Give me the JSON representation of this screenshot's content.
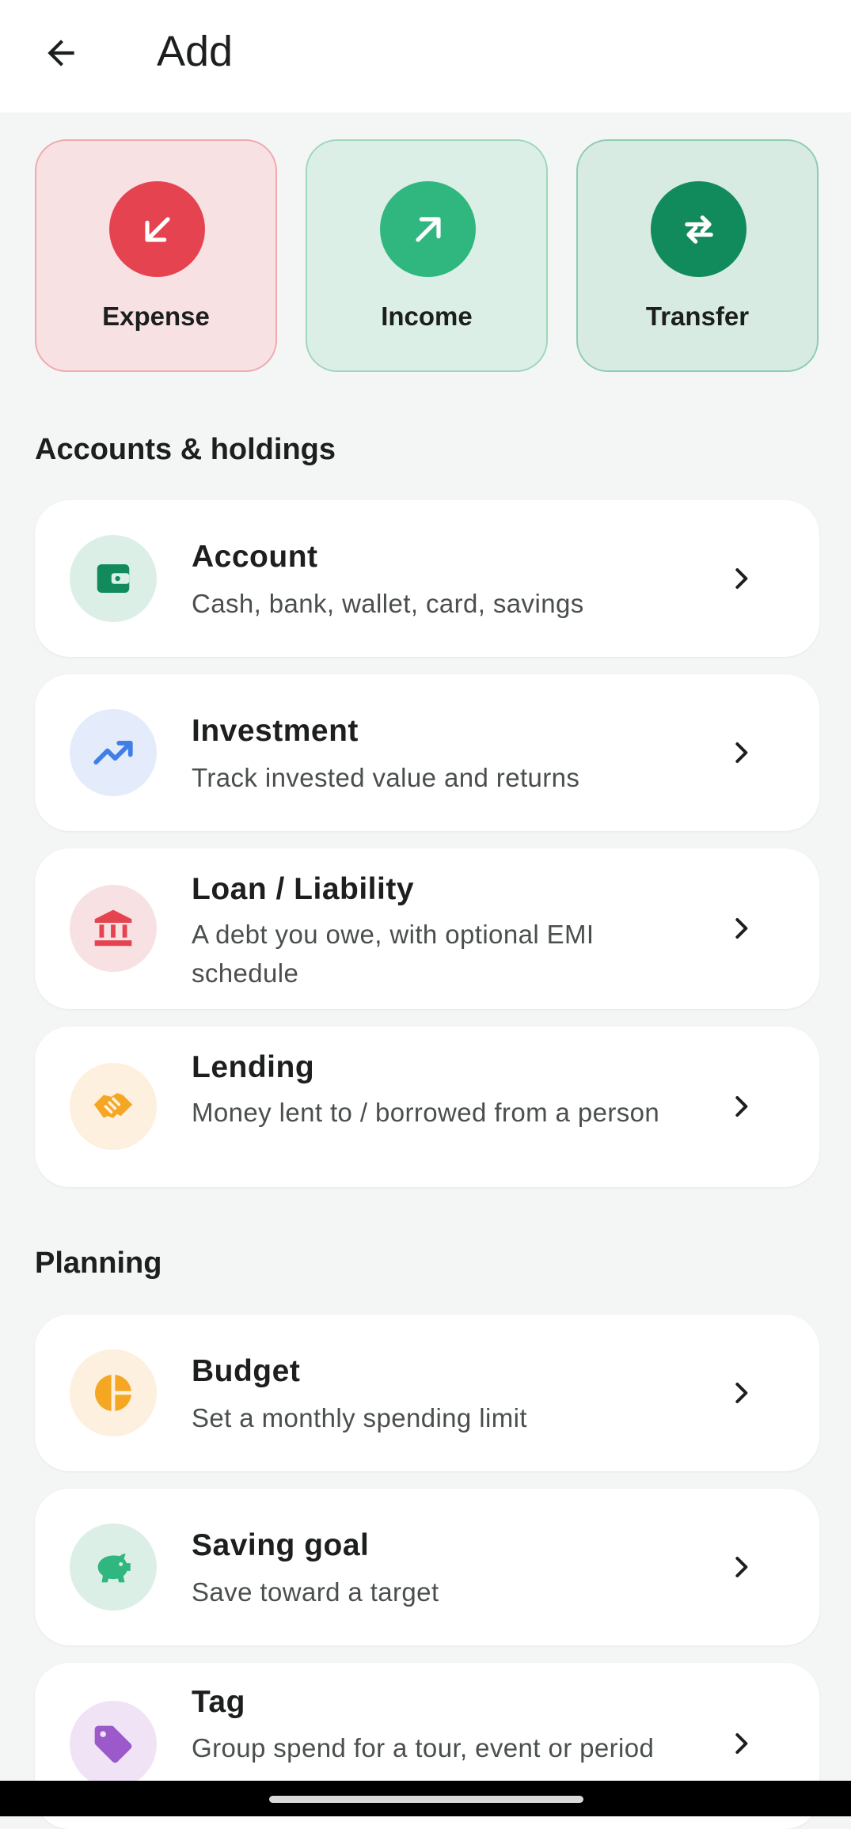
{
  "appbar": {
    "title": "Add"
  },
  "quick_actions": [
    {
      "label": "Expense",
      "icon": "arrow-down-left-icon"
    },
    {
      "label": "Income",
      "icon": "arrow-up-right-icon"
    },
    {
      "label": "Transfer",
      "icon": "swap-arrows-icon"
    }
  ],
  "sections": {
    "accounts_title": "Accounts & holdings",
    "planning_title": "Planning"
  },
  "accounts_items": [
    {
      "title": "Account",
      "subtitle": "Cash, bank, wallet, card, savings",
      "icon": "wallet-icon"
    },
    {
      "title": "Investment",
      "subtitle": "Track invested value and returns",
      "icon": "trending-up-icon"
    },
    {
      "title": "Loan / Liability",
      "subtitle": "A debt you owe, with optional EMI schedule",
      "icon": "bank-icon"
    },
    {
      "title": "Lending",
      "subtitle": "Money lent to / borrowed from a person",
      "icon": "handshake-icon"
    }
  ],
  "planning_items": [
    {
      "title": "Budget",
      "subtitle": "Set a monthly spending limit",
      "icon": "pie-chart-icon"
    },
    {
      "title": "Saving goal",
      "subtitle": "Save toward a target",
      "icon": "piggy-bank-icon"
    },
    {
      "title": "Tag",
      "subtitle": "Group spend for a tour, event or period",
      "icon": "tag-icon"
    }
  ],
  "colors": {
    "expense": "#e5434f",
    "income": "#2fb77f",
    "transfer": "#118a5c",
    "budget": "#f5a623",
    "investment": "#3f7fe6",
    "tag": "#9b59c9"
  }
}
